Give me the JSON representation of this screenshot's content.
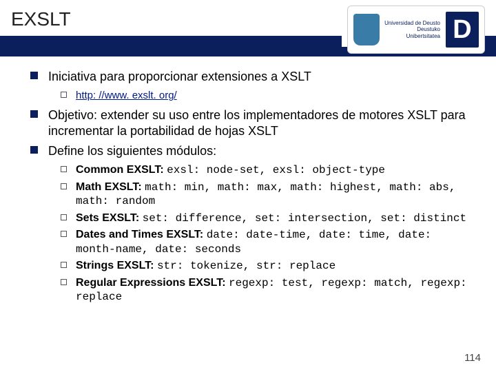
{
  "header": {
    "title": "EXSLT",
    "logo": {
      "line1": "Universidad de Deusto",
      "line2": "Deustuko Unibertsitatea",
      "big_letter": "D"
    }
  },
  "bullets": {
    "b1": "Iniciativa para proporcionar extensiones a XSLT",
    "b1_link_label": "http: //www. exslt. org/",
    "b2": "Objetivo: extender su uso entre los implementadores de motores XSLT para incrementar la portabilidad de hojas XSLT",
    "b3": "Define los siguientes módulos:"
  },
  "modules": {
    "m1_label": "Common EXSLT: ",
    "m1_code": "exsl: node-set, exsl: object-type",
    "m2_label": "Math EXSLT: ",
    "m2_code": "math: min, math: max, math: highest, math: abs, math: random",
    "m3_label": "Sets EXSLT: ",
    "m3_code": "set: difference, set: intersection, set: distinct",
    "m4_label": "Dates and Times EXSLT: ",
    "m4_code": "date: date-time, date: time, date: month-name, date: seconds",
    "m5_label": "Strings EXSLT: ",
    "m5_code": "str: tokenize, str: replace",
    "m6_label": "Regular Expressions EXSLT: ",
    "m6_code": "regexp: test, regexp: match, regexp: replace"
  },
  "footer": {
    "page": "114"
  }
}
